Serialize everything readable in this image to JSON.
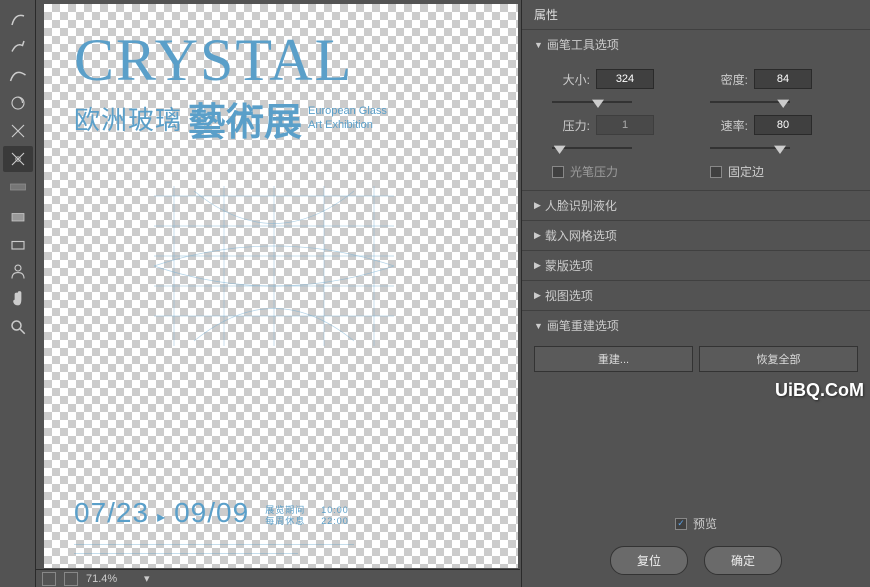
{
  "panel": {
    "title": "属性",
    "sections": {
      "brush_options": "画笔工具选项",
      "face_liquify": "人脸识别液化",
      "mesh_options": "载入网格选项",
      "mask_options": "蒙版选项",
      "view_options": "视图选项",
      "brush_reconstruct": "画笔重建选项"
    },
    "brush": {
      "size_label": "大小:",
      "size_value": "324",
      "density_label": "密度:",
      "density_value": "84",
      "pressure_label": "压力:",
      "pressure_value": "1",
      "rate_label": "速率:",
      "rate_value": "80",
      "stylus_pressure": "光笔压力",
      "pin_edges": "固定边"
    },
    "reconstruct": {
      "rebuild_btn": "重建...",
      "restore_btn": "恢复全部"
    },
    "preview": "预览",
    "reset_btn": "复位",
    "ok_btn": "确定"
  },
  "statusbar": {
    "zoom": "71.4%"
  },
  "poster": {
    "title": "CRYSTAL",
    "sub_cn1": "欧洲玻璃",
    "sub_cn2": "藝術展",
    "sub_en1": "European Glass",
    "sub_en2": "Art Exhibition",
    "date1": "07/23",
    "date_sep": "▸",
    "date2": "09/09",
    "info1": "展览期间",
    "info2": "每周休息",
    "time1": "10:00",
    "time2": "22:00"
  },
  "watermark": "UiBQ.CoM"
}
